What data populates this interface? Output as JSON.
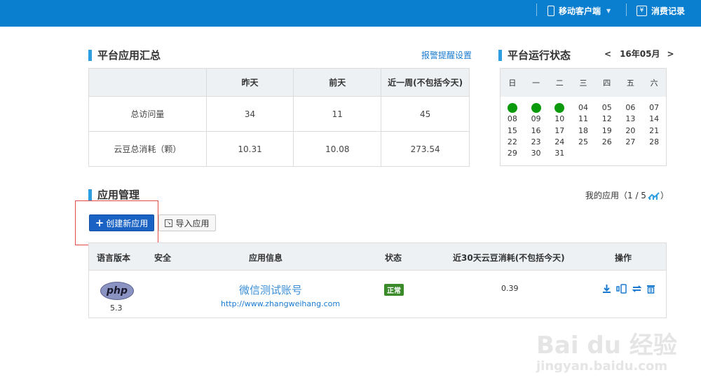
{
  "topbar": {
    "mobile_client": "移动客户端",
    "consumption": "消费记录",
    "yen_glyph": "¥"
  },
  "summary": {
    "title": "平台应用汇总",
    "alert_link": "报警提醒设置",
    "headers": [
      "",
      "昨天",
      "前天",
      "近一周(不包括今天)"
    ],
    "rows": [
      [
        "总访问量",
        "34",
        "11",
        "45"
      ],
      [
        "云豆总消耗（颗）",
        "10.31",
        "10.08",
        "273.54"
      ]
    ]
  },
  "status": {
    "title": "平台运行状态",
    "prev": "<",
    "month": "16年05月",
    "next": ">",
    "weekdays": [
      "日",
      "一",
      "二",
      "三",
      "四",
      "五",
      "六"
    ],
    "days": [
      "",
      "",
      "",
      "04",
      "05",
      "06",
      "07",
      "08",
      "09",
      "10",
      "11",
      "12",
      "13",
      "14",
      "15",
      "16",
      "17",
      "18",
      "19",
      "20",
      "21",
      "22",
      "23",
      "24",
      "25",
      "26",
      "27",
      "28",
      "29",
      "30",
      "31",
      "",
      "",
      "",
      ""
    ],
    "dot_color": "#0b9a0b"
  },
  "apps": {
    "title": "应用管理",
    "my_apps": "我的应用（1 / 5",
    "my_apps_close": "）",
    "create_button": "创建新应用",
    "import_button": "导入应用",
    "headers": {
      "language": "语言版本",
      "security": "安全",
      "info": "应用信息",
      "state": "状态",
      "cost": "近30天云豆消耗(不包括今天)",
      "ops": "操作"
    },
    "row": {
      "lang_logo": "php",
      "lang_version": "5.3",
      "name": "微信测试账号",
      "url": "http://www.zhangweihang.com",
      "state": "正常",
      "cost": "0.39"
    }
  },
  "watermark": {
    "logo": "Bai du 经验",
    "url": "jingyan.baidu.com"
  },
  "colors": {
    "topbar": "#0a7fd0",
    "accent": "#2d9fe0",
    "primary_button": "#1a63c4",
    "highlight_box": "#e34b4b"
  }
}
